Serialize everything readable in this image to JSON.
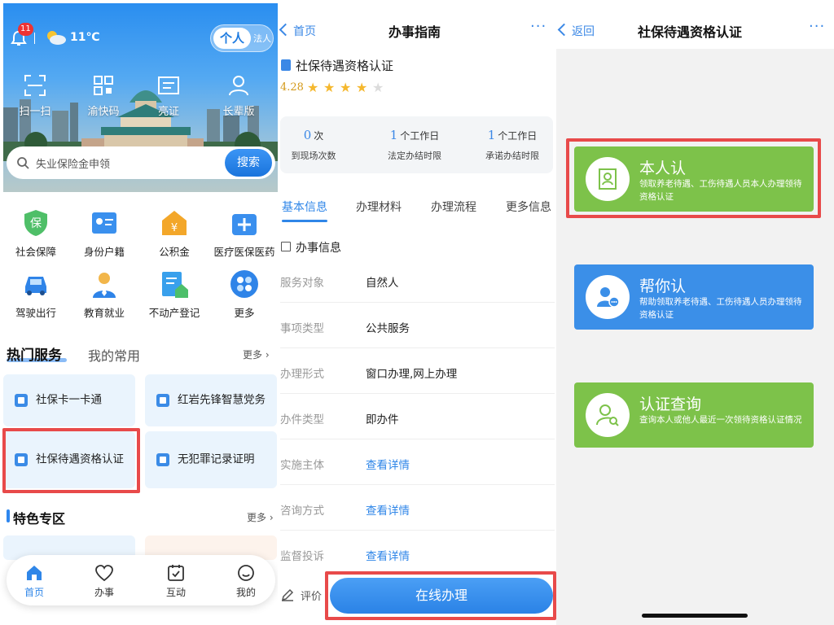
{
  "panel1": {
    "notification_count": "11",
    "temperature": "11℃",
    "toggle_on": "个人",
    "toggle_off": "法人",
    "quick_actions": [
      "扫一扫",
      "渝快码",
      "亮证",
      "长辈版"
    ],
    "search_placeholder": "失业保险金申领",
    "search_button": "搜索",
    "services": [
      "社会保障",
      "身份户籍",
      "公积金",
      "医疗医保医药",
      "驾驶出行",
      "教育就业",
      "不动产登记",
      "更多"
    ],
    "tab_hot": "热门服务",
    "tab_fav": "我的常用",
    "more": "更多",
    "hot_cards": [
      "社保卡一卡通",
      "红岩先锋智慧党务",
      "社保待遇资格认证",
      "无犯罪记录证明"
    ],
    "feature_title": "特色专区",
    "feature_more": "更多",
    "nav": [
      "首页",
      "办事",
      "互动",
      "我的"
    ]
  },
  "panel2": {
    "back": "首页",
    "title": "办事指南",
    "dots": "···",
    "item_title": "社保待遇资格认证",
    "score": "4.28",
    "stats": [
      {
        "value": "0",
        "unit": "次",
        "label": "到现场次数"
      },
      {
        "value": "1",
        "unit": "个工作日",
        "label": "法定办结时限"
      },
      {
        "value": "1",
        "unit": "个工作日",
        "label": "承诺办结时限"
      }
    ],
    "tabs": [
      "基本信息",
      "办理材料",
      "办理流程",
      "更多信息"
    ],
    "info_header": "办事信息",
    "rows": [
      {
        "key": "服务对象",
        "value": "自然人"
      },
      {
        "key": "事项类型",
        "value": "公共服务"
      },
      {
        "key": "办理形式",
        "value": "窗口办理,网上办理"
      },
      {
        "key": "办件类型",
        "value": "即办件"
      },
      {
        "key": "实施主体",
        "value": "查看详情"
      },
      {
        "key": "咨询方式",
        "value": "查看详情"
      },
      {
        "key": "监督投诉",
        "value": "查看详情"
      }
    ],
    "evaluate": "评价",
    "online_button": "在线办理"
  },
  "panel3": {
    "back": "返回",
    "title": "社保待遇资格认证",
    "dots": "···",
    "options": [
      {
        "title": "本人认",
        "desc": "领取养老待遇、工伤待遇人员本人办理领待资格认证",
        "color": "#7dc24a"
      },
      {
        "title": "帮你认",
        "desc": "帮助领取养老待遇、工伤待遇人员办理领待资格认证",
        "color": "#3b8fe8"
      },
      {
        "title": "认证查询",
        "desc": "查询本人或他人最近一次领待资格认证情况",
        "color": "#7dc24a"
      }
    ]
  },
  "colors": {
    "accent": "#2f86e8",
    "highlight": "#e84a4a",
    "green": "#7dc24a"
  }
}
